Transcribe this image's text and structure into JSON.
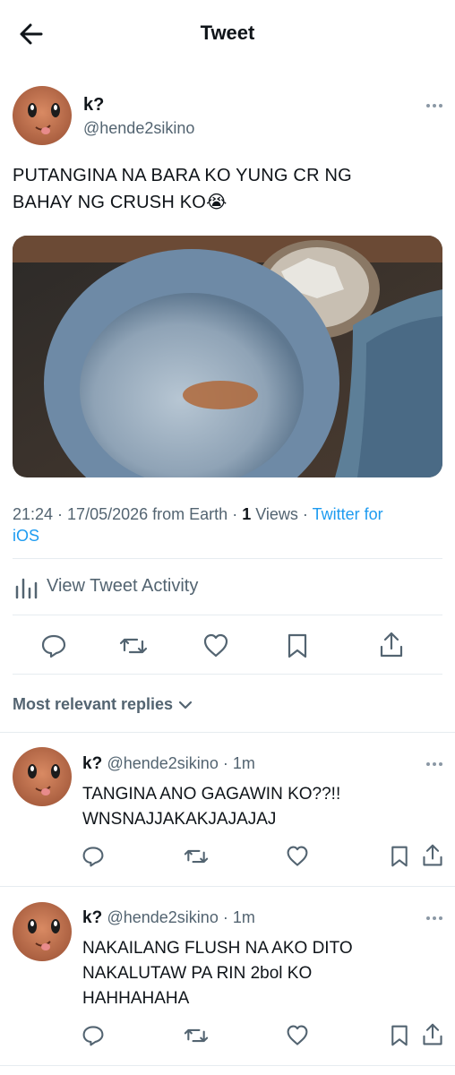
{
  "header": {
    "title": "Tweet"
  },
  "tweet": {
    "author_name": "k?",
    "author_handle": "@hende2sikino",
    "text_line1": "PUTANGINA NA BARA KO YUNG CR NG",
    "text_line2": "BAHAY NG CRUSH KO😭",
    "meta": {
      "time": "21:24",
      "date": "17/05/2026",
      "from": "from Earth",
      "views_count": "1",
      "views_label": "Views",
      "client_line1": "Twitter for",
      "client_line2": "iOS"
    },
    "activity_label": "View Tweet Activity"
  },
  "replies_section": {
    "sort_label": "Most relevant replies"
  },
  "replies": [
    {
      "author_name": "k?",
      "author_handle": "@hende2sikino",
      "time": "1m",
      "line1": "TANGINA ANO GAGAWIN KO??!!",
      "line2": "WNSNAJJAKAKJAJAJAJ",
      "line3": ""
    },
    {
      "author_name": "k?",
      "author_handle": "@hende2sikino",
      "time": "1m",
      "line1": "NAKAILANG FLUSH NA AKO DITO",
      "line2": "NAKALUTAW PA RIN 2bol KO",
      "line3": "HAHHAHAHA"
    }
  ],
  "colors": {
    "accent": "#1d9bf0",
    "secondary_text": "#536471",
    "divider": "#e6ecf0"
  },
  "icons": [
    "back-arrow-icon",
    "more-icon",
    "reply-icon",
    "retweet-icon",
    "like-icon",
    "bookmark-icon",
    "share-icon",
    "activity-chart-icon",
    "chevron-down-icon"
  ]
}
